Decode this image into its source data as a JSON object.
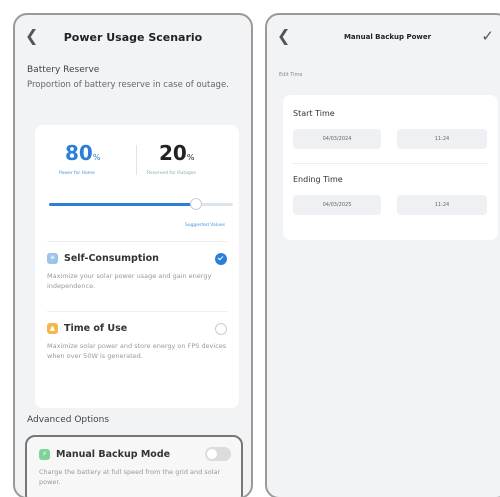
{
  "left": {
    "title": "Power Usage Scenario",
    "battery_reserve_label": "Battery Reserve",
    "battery_reserve_desc": "Proportion of battery reserve in case of outage.",
    "home_pct": "80",
    "outage_pct": "20",
    "pct_symbol": "%",
    "home_sub": "Power for Home",
    "outage_sub": "Reserved for Outages",
    "slider_value_pct": 80,
    "suggested_label": "Suggested Values",
    "options": [
      {
        "title": "Self-Consumption",
        "desc": "Maximize your solar power usage and gain energy independence.",
        "selected": true,
        "icon": "sun-icon",
        "icon_color": "#9cc3ea"
      },
      {
        "title": "Time of Use",
        "desc": "Maximize solar power and store energy on FPS devices when over 50W is generated.",
        "selected": false,
        "icon": "clock-icon",
        "icon_color": "#f2b84b"
      }
    ],
    "advanced_label": "Advanced Options",
    "backup": {
      "title": "Manual Backup Mode",
      "desc": "Charge the battery at full speed from the grid and solar power.",
      "enabled": false
    }
  },
  "right": {
    "title": "Manual Backup Power",
    "edit_time_label": "Edit Time",
    "start_label": "Start Time",
    "start_date": "04/03/2024",
    "start_time": "11:24",
    "end_label": "Ending Time",
    "end_date": "04/03/2025",
    "end_time": "11:24"
  },
  "colors": {
    "accent": "#2b7fd6"
  }
}
